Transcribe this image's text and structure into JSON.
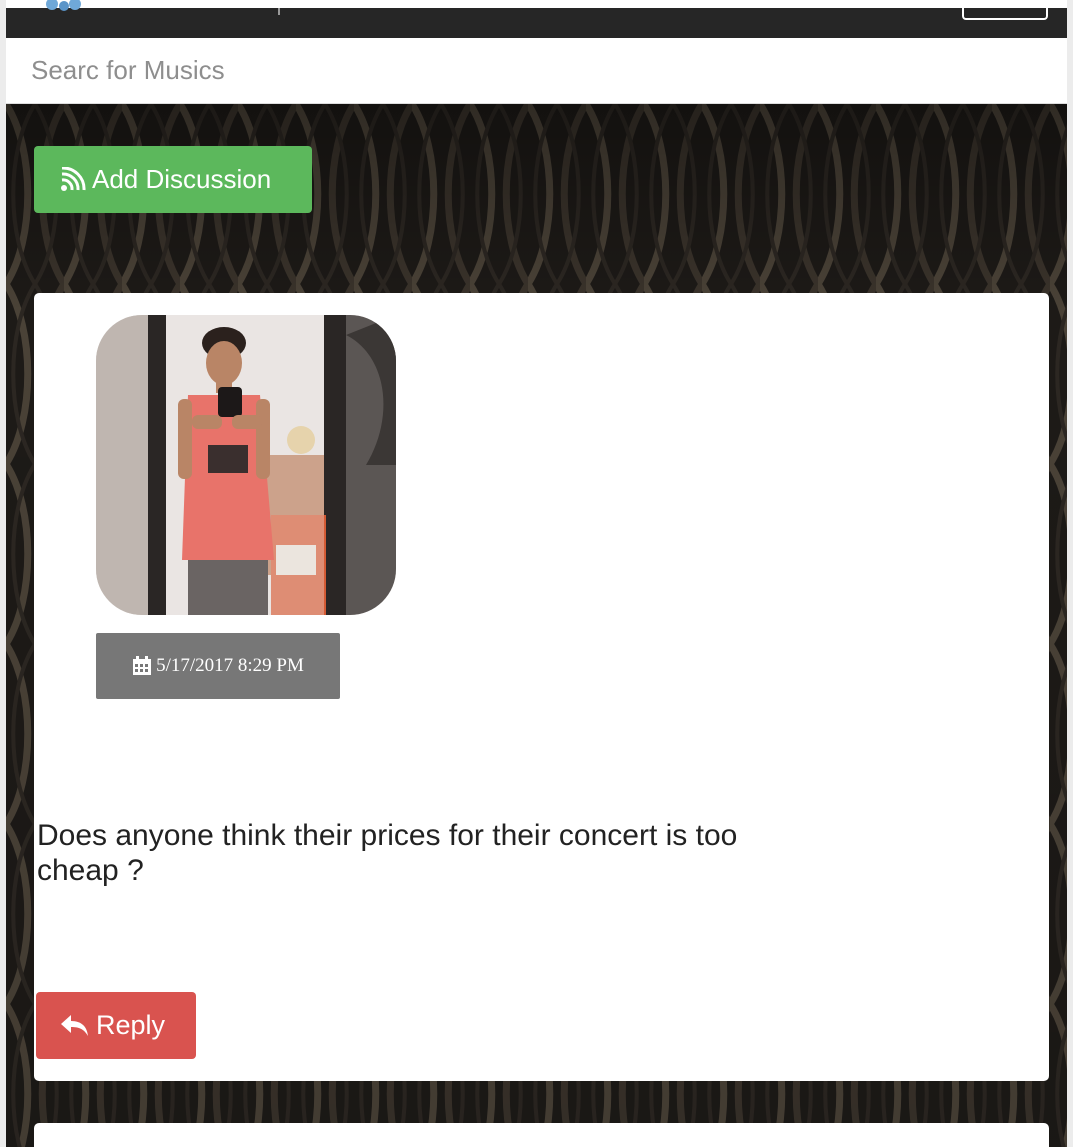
{
  "search": {
    "placeholder": "Searc for Musics",
    "value": ""
  },
  "toolbar": {
    "add_discussion_label": "Add Discussion",
    "add_discussion_icon": "signal-waves-icon"
  },
  "post": {
    "avatar_description": "user-avatar-photo",
    "date_icon": "calendar-icon",
    "date": "5/17/2017 8:29 PM",
    "text": "Does anyone think their prices for their concert is too cheap ?",
    "reply_label": "Reply",
    "reply_icon": "reply-arrow-icon"
  },
  "colors": {
    "topbar": "#262626",
    "add_button": "#5cb85c",
    "reply_button": "#d9534f",
    "date_badge": "#777777",
    "background_pattern": "#1f1c18"
  }
}
